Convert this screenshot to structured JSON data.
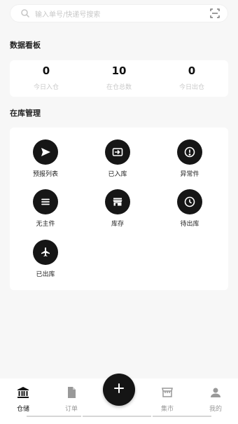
{
  "search": {
    "placeholder": "输入单号/快递号搜索"
  },
  "dashboard": {
    "title": "数据看板",
    "stats": [
      {
        "value": "0",
        "label": "今日入仓"
      },
      {
        "value": "10",
        "label": "在仓总数"
      },
      {
        "value": "0",
        "label": "今日出仓"
      }
    ]
  },
  "management": {
    "title": "在库管理",
    "items": [
      {
        "label": "预报列表",
        "icon": "send-icon"
      },
      {
        "label": "已入库",
        "icon": "inbox-in-icon"
      },
      {
        "label": "异常件",
        "icon": "alert-circle-icon"
      },
      {
        "label": "无主件",
        "icon": "list-icon"
      },
      {
        "label": "库存",
        "icon": "store-icon"
      },
      {
        "label": "待出库",
        "icon": "clock-icon"
      },
      {
        "label": "已出库",
        "icon": "airplane-icon"
      }
    ]
  },
  "tabbar": {
    "tabs": [
      {
        "label": "仓储",
        "icon": "warehouse-icon",
        "active": true
      },
      {
        "label": "订单",
        "icon": "document-icon",
        "active": false
      },
      {
        "label": "集市",
        "icon": "market-icon",
        "active": false
      },
      {
        "label": "我的",
        "icon": "person-icon",
        "active": false
      }
    ],
    "fab_icon": "plus-icon"
  },
  "colors": {
    "background": "#f7f7f7",
    "card": "#ffffff",
    "icon_circle": "#161616",
    "muted_text": "#c9c9c9"
  }
}
